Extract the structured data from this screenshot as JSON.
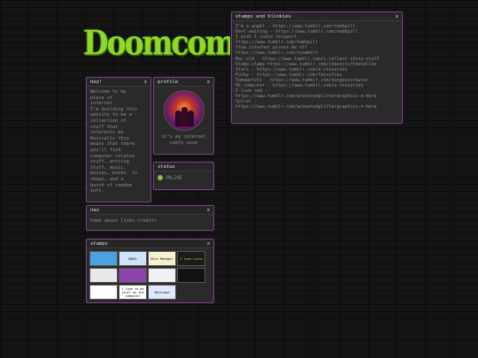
{
  "logo": {
    "text": "Doomcoming"
  },
  "stamps_blinkies": {
    "title": "stamps and blinkies",
    "lines": [
      "I'm a angel - https://www.tumblr.com/numbpill",
      "Devl waiting - https://www.tumblr.com/numbpill",
      "I wish I could teleport -",
      "https://www.tumblr.com/numbpill",
      "Slow internet pisses me off -",
      "https://www.tumblr.com/nyaamers",
      "Mac old - https://www.tumblr.com/i-collect-shiny-stuff",
      "Stamp-stamp https://www.tumblr.com/cheezitsfthevalley",
      "Stars - https://www.tumblr.com/e-resources",
      "Furby - https://www.tumblr.com/fairyfies",
      "Tamagotchi - https://www.tumblr.com/dungeoncrawler",
      "Ok computer - https://www.tumblr.com/e-resources",
      "I love cmd -",
      "https://www.tumblr.com/animatedglittergraphics-n-more",
      "Spiral -",
      "https://www.tumblr.com/animatedglittergraphics-n-more"
    ]
  },
  "hey": {
    "title": "hey!",
    "lines": [
      "Welcome to my",
      "piece of",
      "internet",
      "I'm building this",
      "website to be a",
      "collection of",
      "stuff that",
      "interests me.",
      "Basically this",
      "means that there",
      "you'll find",
      "computer-related",
      "stuff, writing",
      "stuff, music,",
      "movies, books, tv",
      "shows, and a",
      "bunch of random",
      "info."
    ]
  },
  "profile": {
    "title": "profile",
    "caption": "it's my internet\ncomfy zone"
  },
  "status": {
    "title": "status",
    "value": "ONLINE"
  },
  "nav": {
    "title": "nav",
    "links": [
      "home",
      "about",
      "links",
      "credits"
    ]
  },
  "stamps": {
    "title": "stamps",
    "items": [
      {
        "label": "",
        "bg": "#4aa3e0"
      },
      {
        "label": "ANGEL",
        "bg": "#cfe3ff"
      },
      {
        "label": "Nice Manager",
        "bg": "#f4f0d0"
      },
      {
        "label": "I love Linux",
        "bg": "#1b1b1b"
      },
      {
        "label": "",
        "bg": "#e8e8e8"
      },
      {
        "label": "",
        "bg": "#8e44ad"
      },
      {
        "label": "",
        "bg": "#f0f0f0"
      },
      {
        "label": "",
        "bg": "#111111"
      },
      {
        "label": "",
        "bg": "#ffffff"
      },
      {
        "label": "I love to do stuff on the computer",
        "bg": "#ffffff"
      },
      {
        "label": "Netscape",
        "bg": "#dfe6ff"
      }
    ],
    "colors": {
      "linux_text": "#7cfc00"
    }
  },
  "close_glyph": "x",
  "accent": "#7a3f8a"
}
